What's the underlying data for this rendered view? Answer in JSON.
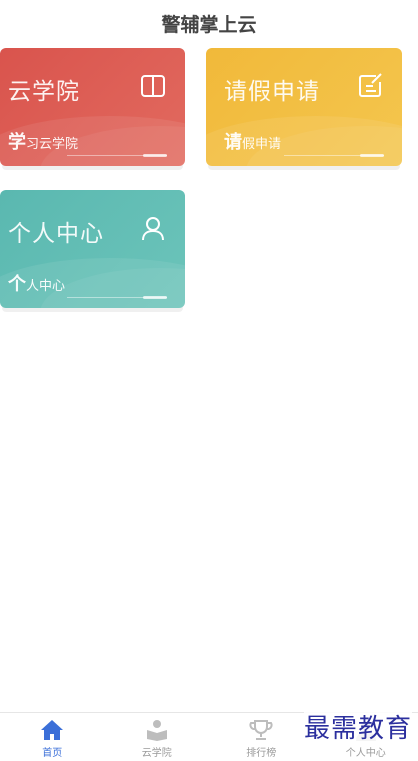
{
  "header": {
    "title": "警辅掌上云"
  },
  "cards": [
    {
      "title": "云学院",
      "sub_first": "学",
      "sub_rest": "习云学院",
      "icon": "book-icon",
      "color": "#d9544d"
    },
    {
      "title": "请假申请",
      "sub_first": "请",
      "sub_rest": "假申请",
      "icon": "edit-icon",
      "color": "#f1b93a"
    },
    {
      "title": "个人中心",
      "sub_first": "个",
      "sub_rest": "人中心",
      "icon": "user-icon",
      "color": "#5ab8b0"
    }
  ],
  "tabs": [
    {
      "label": "首页",
      "icon": "home-icon",
      "active": true
    },
    {
      "label": "云学院",
      "icon": "reader-icon",
      "active": false
    },
    {
      "label": "排行榜",
      "icon": "trophy-icon",
      "active": false
    },
    {
      "label": "个人中心",
      "icon": "person-icon",
      "active": false
    }
  ],
  "watermark": "最需教育",
  "colors": {
    "active_tab": "#3b6fd8",
    "inactive_tab": "#9a9a9a"
  }
}
